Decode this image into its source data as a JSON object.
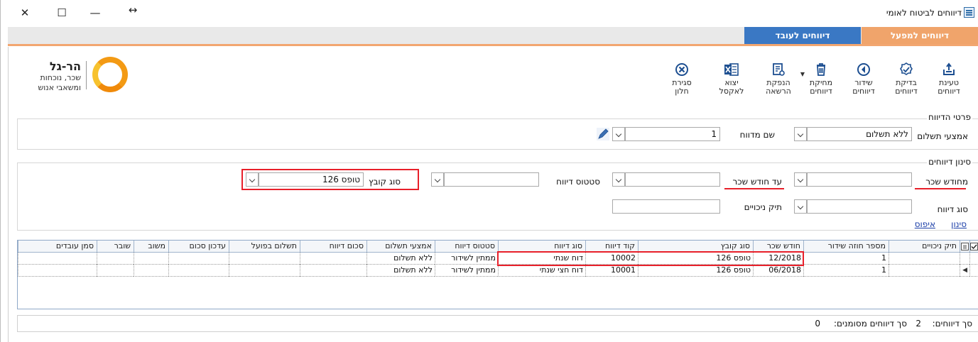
{
  "window": {
    "title": "דיווחים לביטוח לאומי",
    "controls": {
      "close": "✕",
      "maximize": "☐",
      "minimize": "—",
      "restore": "↔"
    }
  },
  "tabs": [
    {
      "label": "דיווחים למפעל",
      "active": true
    },
    {
      "label": "דיווחים לעובד",
      "active": false
    }
  ],
  "toolbar": {
    "load": "טעינת\nדיווחים",
    "check": "בדיקת\nדיווחים",
    "send": "שידור\nדיווחים",
    "delete": "מחיקת\nדיווחים",
    "issue_permit": "הנפקת\nהרשאה",
    "export_excel": "יצוא\nלאקסל",
    "close_window": "סגירת\nחלון"
  },
  "logo": {
    "name": "הר-גל",
    "line1": "שכר, נוכחות",
    "line2": "ומשאבי אנוש"
  },
  "report_details": {
    "title": "פרטי הדיווח",
    "payment_method_label": "אמצעי תשלום",
    "payment_method_value": "ללא תשלום",
    "reporter_name_label": "שם מדווח",
    "reporter_name_value": "1"
  },
  "filter": {
    "title": "סינון דיווחים",
    "from_month_label": "מחודש שכר",
    "from_month_value": "",
    "to_month_label": "עד חודש שכר",
    "to_month_value": "",
    "status_label": "סטטוס דיווח",
    "status_value": "",
    "file_type_label": "סוג קובץ",
    "file_type_value": "טופס 126",
    "report_type_label": "סוג דיווח",
    "report_type_value": "",
    "deductions_file_label": "תיק ניכויים",
    "deductions_file_value": "",
    "filter_link": "סינון",
    "reset_link": "איפוס"
  },
  "grid": {
    "columns": [
      "תיק ניכויים",
      "מספר חוזה שידור",
      "חודש שכר",
      "סוג קובץ",
      "קוד דיווח",
      "סוג דיווח",
      "סטטוס דיווח",
      "אמצעי תשלום",
      "סכום דיווח",
      "תשלום בפועל",
      "עדכון סכום",
      "משוב",
      "שובר",
      "סמן עובדים"
    ],
    "rows": [
      {
        "deductions_file": "",
        "contract_no": "1",
        "month": "12/2018",
        "file_type": "טופס 126",
        "code": "10002",
        "type": "דוח שנתי",
        "status": "ממתין לשידור",
        "payment": "ללא תשלום"
      },
      {
        "deductions_file": "",
        "contract_no": "1",
        "month": "06/2018",
        "file_type": "טופס 126",
        "code": "10001",
        "type": "דוח חצי שנתי",
        "status": "ממתין לשידור",
        "payment": "ללא תשלום"
      }
    ]
  },
  "footer": {
    "total_label": "סך דיווחים:",
    "total_value": "2",
    "selected_label": "סך דיווחים מסומנים:",
    "selected_value": "0"
  },
  "colors": {
    "tab_active": "#f0a46b",
    "tab_inactive": "#3a78c4",
    "highlight": "#e8202a",
    "link": "#1c3fa8"
  }
}
